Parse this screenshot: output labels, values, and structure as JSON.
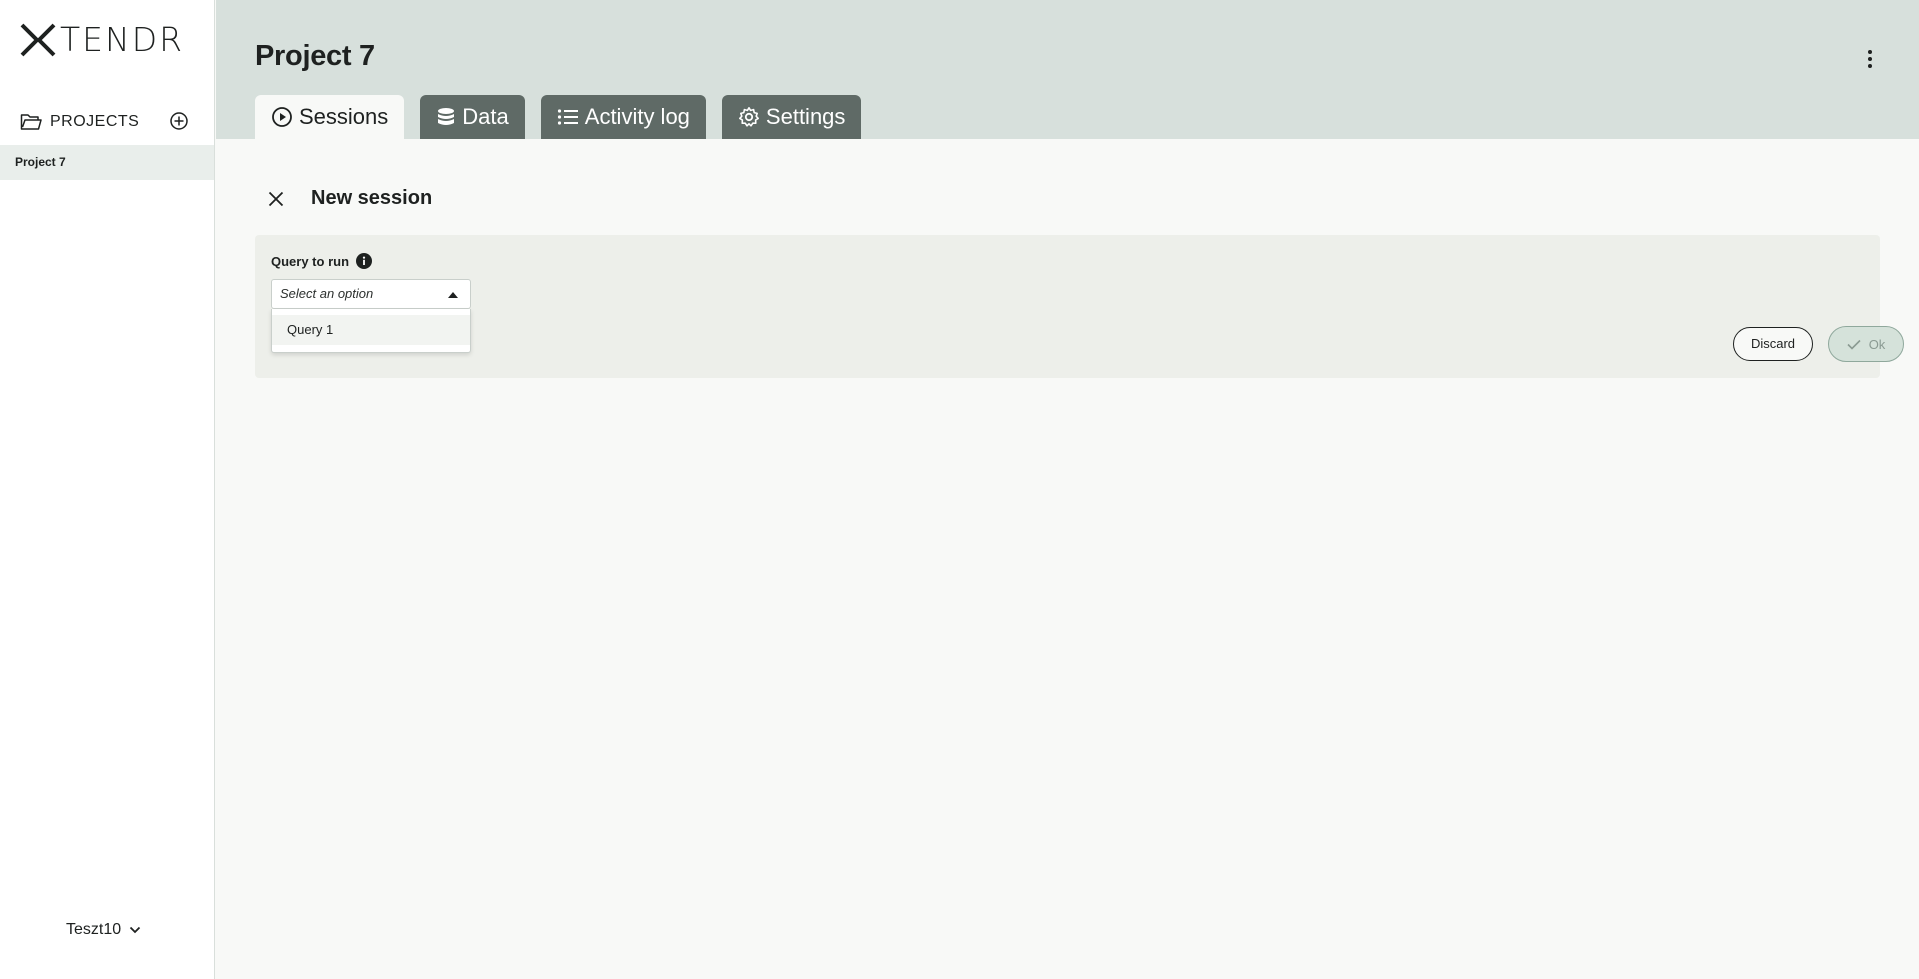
{
  "brand": {
    "logo_text": "TENDR"
  },
  "sidebar": {
    "projects_label": "PROJECTS",
    "items": [
      {
        "label": "Project 7"
      }
    ],
    "user": {
      "name": "Teszt10"
    }
  },
  "header": {
    "title": "Project 7",
    "tabs": [
      {
        "label": "Sessions",
        "icon": "play-circle-icon",
        "active": true
      },
      {
        "label": "Data",
        "icon": "database-icon",
        "active": false
      },
      {
        "label": "Activity log",
        "icon": "list-icon",
        "active": false
      },
      {
        "label": "Settings",
        "icon": "gear-icon",
        "active": false
      }
    ]
  },
  "session": {
    "title": "New session",
    "query_label": "Query to run",
    "select": {
      "placeholder": "Select an option"
    },
    "options": [
      {
        "label": "Query 1"
      }
    ],
    "discard_label": "Discard",
    "ok_label": "Ok"
  },
  "colors": {
    "header_bg": "#d7e0dc",
    "tab_inactive": "#5f6a66",
    "panel_bg": "#edefea",
    "ok_bg": "#d5e2da"
  }
}
